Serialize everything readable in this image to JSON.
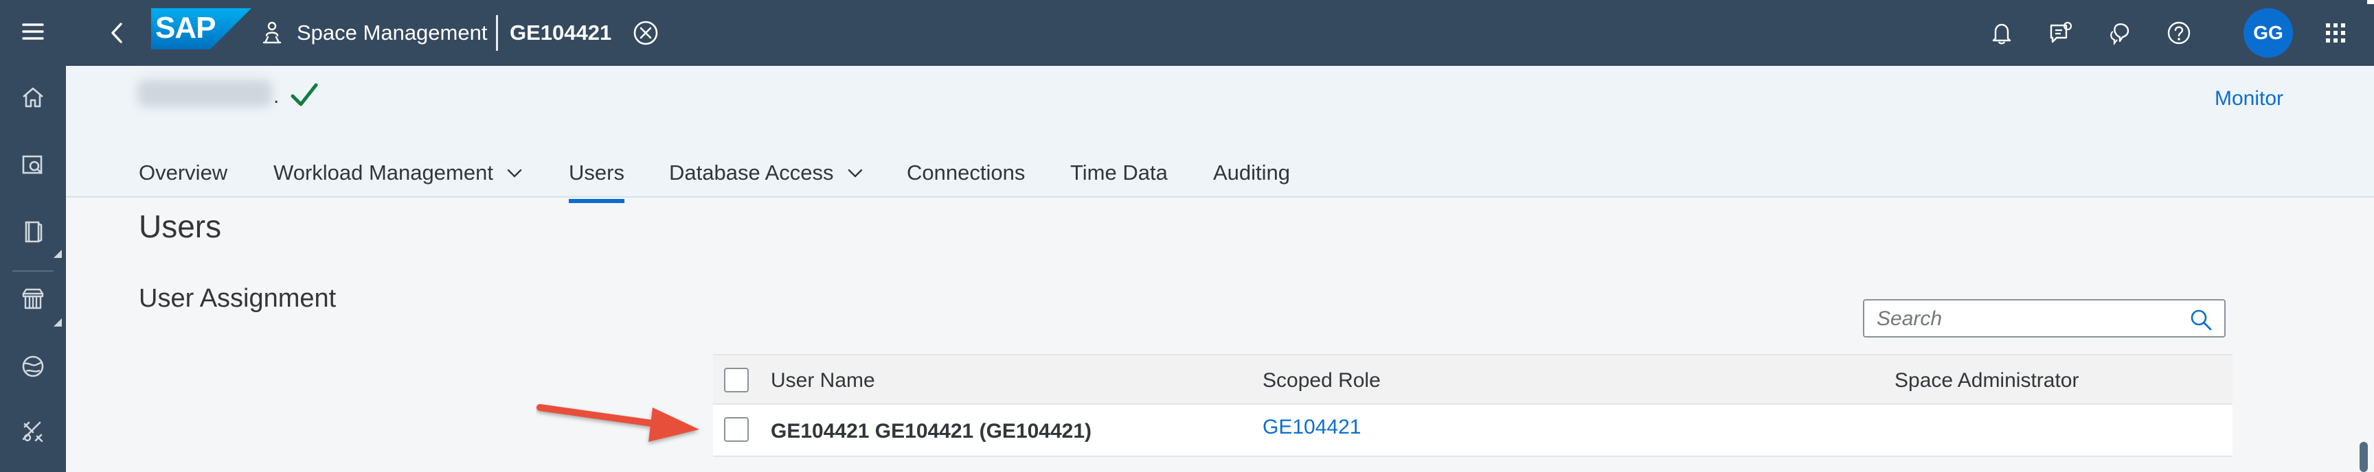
{
  "shell": {
    "logo_text": "SAP",
    "app_title": "Space Management",
    "space_id": "GE104421",
    "avatar_initials": "GG",
    "actions": [
      "bell-icon",
      "feedback-icon",
      "chat-icon",
      "help-icon"
    ],
    "apps_icon": "grid-icon"
  },
  "siderail": {
    "items": [
      "home-icon",
      "data-builder-icon",
      "business-builder-icon",
      "marketplace-icon",
      "connections-icon",
      "admin-tools-icon"
    ]
  },
  "object": {
    "name_suffix": ".",
    "status_icon": "checkmark-icon",
    "monitor_label": "Monitor"
  },
  "tabs": [
    {
      "label": "Overview",
      "dropdown": false
    },
    {
      "label": "Workload Management",
      "dropdown": true
    },
    {
      "label": "Users",
      "dropdown": false,
      "selected": true
    },
    {
      "label": "Database Access",
      "dropdown": true
    },
    {
      "label": "Connections",
      "dropdown": false
    },
    {
      "label": "Time Data",
      "dropdown": false
    },
    {
      "label": "Auditing",
      "dropdown": false
    }
  ],
  "content": {
    "page_title": "Users",
    "section_title": "User Assignment",
    "search": {
      "placeholder": "Search",
      "value": ""
    }
  },
  "table": {
    "columns": [
      "User Name",
      "Scoped Role",
      "Space Administrator"
    ],
    "rows": [
      {
        "user_name": "GE104421 GE104421 (GE104421)",
        "scoped_role": "GE104421",
        "space_admin": ""
      }
    ]
  },
  "colors": {
    "shell_bg": "#354a5f",
    "accent": "#0a6ed1",
    "header_bg": "#eff4f9",
    "page_bg": "#f5f6f7",
    "success": "#107e3e",
    "arrow": "#e8503a"
  }
}
